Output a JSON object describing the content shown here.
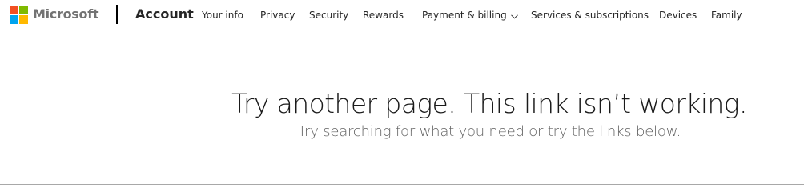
{
  "header": {
    "brand": "Microsoft",
    "product": "Account",
    "logo_colors": [
      "#f25022",
      "#7fba00",
      "#00a4ef",
      "#ffb900"
    ],
    "nav": [
      {
        "label": "Your info"
      },
      {
        "label": "Privacy"
      },
      {
        "label": "Security"
      },
      {
        "label": "Rewards"
      },
      {
        "label": "Payment & billing",
        "icon": "chevron-down-icon"
      },
      {
        "label": "Services & subscriptions"
      },
      {
        "label": "Devices"
      },
      {
        "label": "Family"
      }
    ]
  },
  "main": {
    "title": "Try another page. This link isn’t working.",
    "subtitle": "Try searching for what you need or try the links below."
  }
}
